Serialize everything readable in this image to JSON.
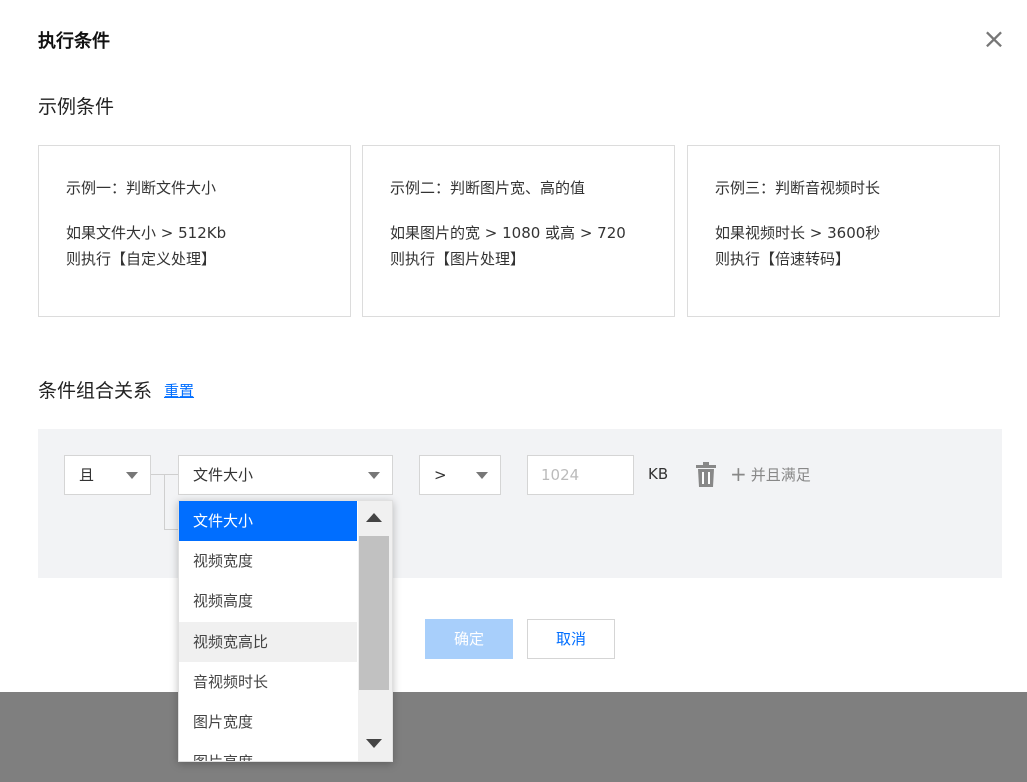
{
  "modal": {
    "title": "执行条件",
    "close_icon": "close-icon"
  },
  "examples": {
    "section_title": "示例条件",
    "cards": [
      {
        "heading": "示例一：判断文件大小",
        "condition": "如果文件大小 > 512Kb",
        "action": "则执行【自定义处理】"
      },
      {
        "heading": "示例二：判断图片宽、高的值",
        "condition": "如果图片的宽 > 1080 或高 > 720",
        "action": "则执行【图片处理】"
      },
      {
        "heading": "示例三：判断音视频时长",
        "condition": "如果视频时长 > 3600秒",
        "action": "则执行【倍速转码】"
      }
    ]
  },
  "combination": {
    "title": "条件组合关系",
    "reset_label": "重置"
  },
  "rule": {
    "logic_value": "且",
    "field_value": "文件大小",
    "operator_value": ">",
    "value_placeholder": "1024",
    "unit": "KB",
    "add_label": "并且满足",
    "delete_icon": "trash-icon"
  },
  "dropdown": {
    "options": [
      "文件大小",
      "视频宽度",
      "视频高度",
      "视频宽高比",
      "音视频时长",
      "图片宽度",
      "图片高度"
    ],
    "selected": "文件大小",
    "hovered": "视频宽高比"
  },
  "footer": {
    "confirm_label": "确定",
    "cancel_label": "取消"
  },
  "colors": {
    "accent": "#006eff",
    "confirm_disabled": "#a8cffb",
    "panel_bg": "#f2f3f5",
    "overlay": "#7f7f7f"
  }
}
